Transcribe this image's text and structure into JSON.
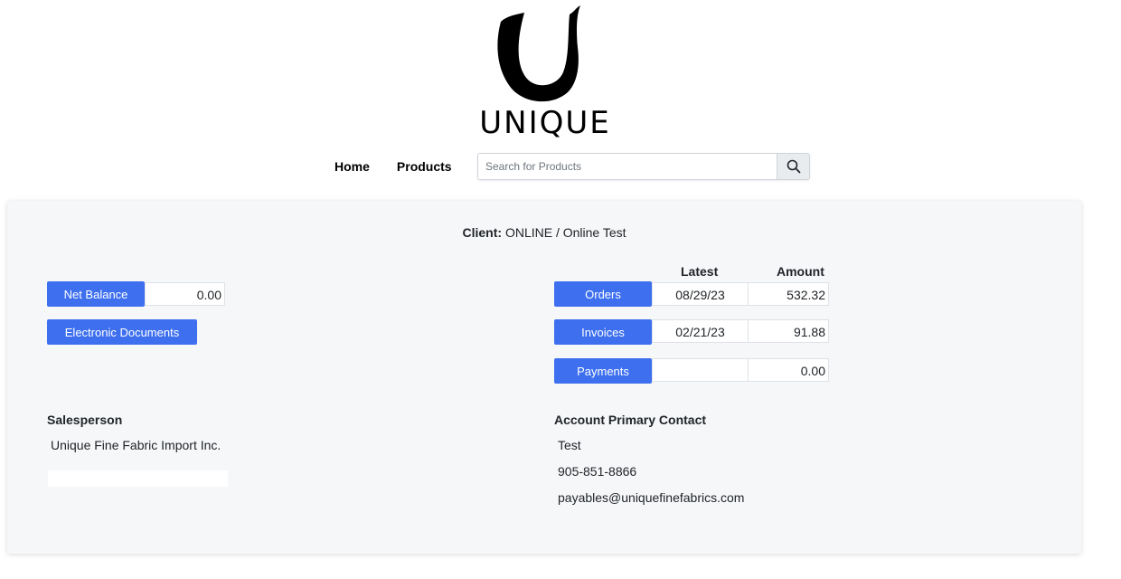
{
  "logo": {
    "text": "UNIQUE",
    "icon": "unique-u-logo"
  },
  "nav": {
    "home": "Home",
    "products": "Products"
  },
  "search": {
    "placeholder": "Search for Products",
    "icon": "search-icon"
  },
  "client": {
    "label": "Client:",
    "value": "ONLINE / Online Test"
  },
  "account": {
    "net_balance_label": "Net Balance",
    "net_balance_value": "0.00",
    "edocs_label": "Electronic Documents"
  },
  "summary": {
    "headers": {
      "latest": "Latest",
      "amount": "Amount"
    },
    "rows": [
      {
        "label": "Orders",
        "latest": "08/29/23",
        "amount": "532.32"
      },
      {
        "label": "Invoices",
        "latest": "02/21/23",
        "amount": "91.88"
      },
      {
        "label": "Payments",
        "latest": "",
        "amount": "0.00"
      }
    ]
  },
  "salesperson": {
    "title": "Salesperson",
    "name": "Unique Fine Fabric Import Inc."
  },
  "contact": {
    "title": "Account Primary Contact",
    "name": "Test",
    "phone": "905-851-8866",
    "email": "payables@uniquefinefabrics.com"
  },
  "colors": {
    "accent": "#3d6fef",
    "card_bg": "#f6f7f9"
  }
}
